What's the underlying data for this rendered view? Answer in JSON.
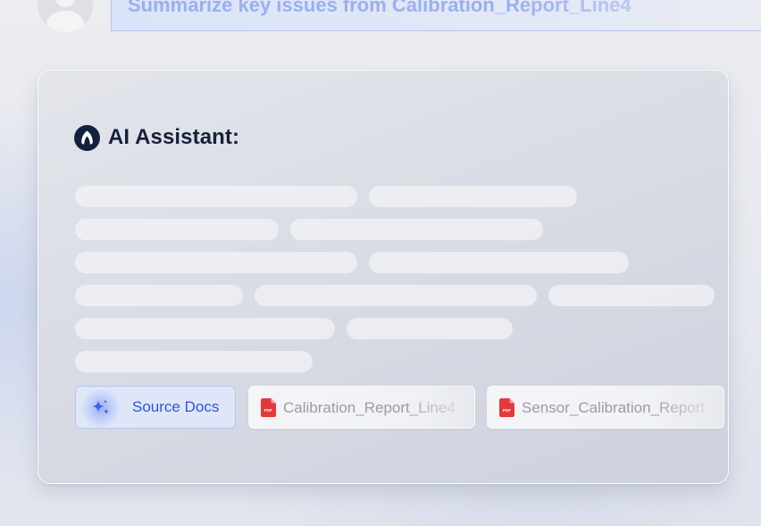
{
  "user_query": {
    "text": "Summarize key issues from Calibration_Report_Line4"
  },
  "assistant": {
    "title": "AI Assistant:",
    "status": "loading"
  },
  "sources": {
    "label": "Source Docs",
    "files": [
      {
        "name": "Calibration_Report_Line4",
        "type": "PDF"
      },
      {
        "name": "Sensor_Calibration_Report",
        "type": "PDF"
      }
    ]
  },
  "colors": {
    "accent": "#2f55d4",
    "assistant_logo": "#14213d",
    "pdf_icon": "#e5383b",
    "query_text": "#9ab0ee"
  },
  "icons": {
    "user": "user-avatar-icon",
    "assistant": "assistant-logo-icon",
    "sources": "sparkle-icon",
    "file": "pdf-file-icon"
  }
}
